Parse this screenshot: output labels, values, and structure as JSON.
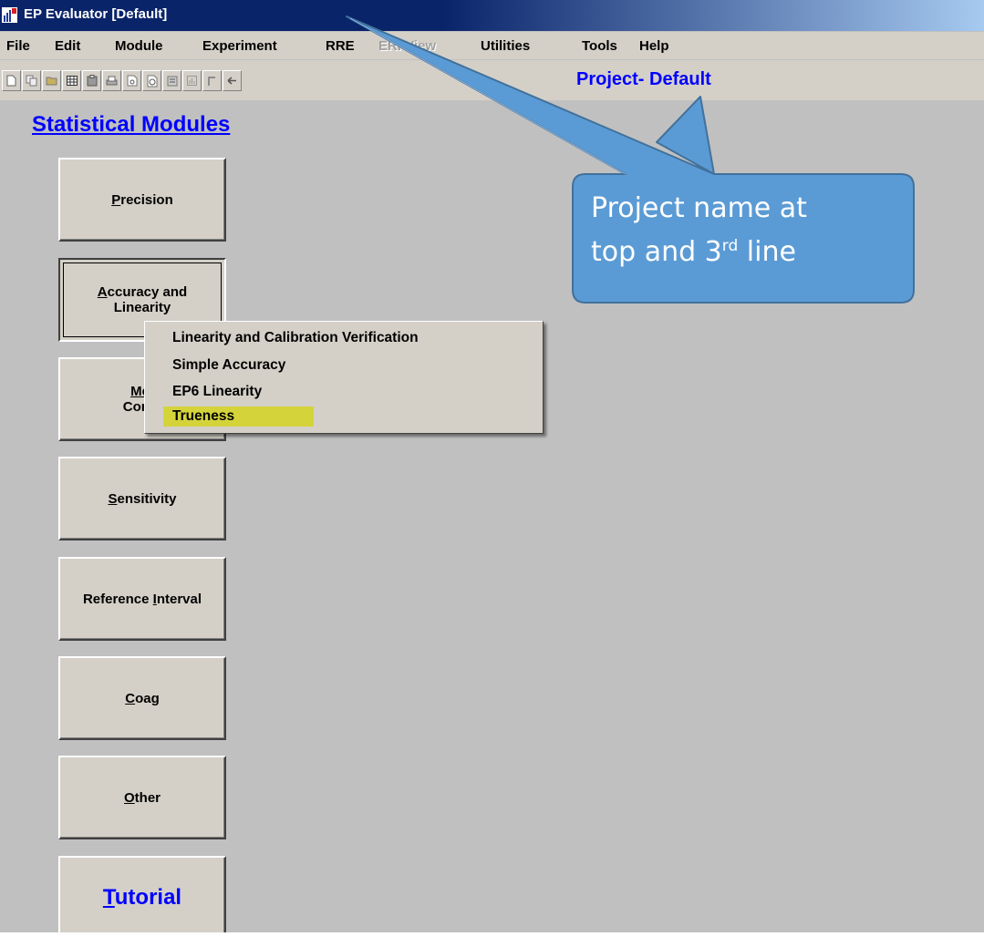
{
  "window": {
    "title": "EP Evaluator [Default]",
    "icon": "ep-evaluator-app-icon"
  },
  "menubar": {
    "items": [
      {
        "label": "File",
        "enabled": true
      },
      {
        "label": "Edit",
        "enabled": true
      },
      {
        "label": "Module",
        "enabled": true
      },
      {
        "label": "Experiment",
        "enabled": true
      },
      {
        "label": "RRE",
        "enabled": true
      },
      {
        "label": "ERI View",
        "enabled": false
      },
      {
        "label": "Utilities",
        "enabled": true
      },
      {
        "label": "Tools",
        "enabled": true
      },
      {
        "label": "Help",
        "enabled": true
      }
    ]
  },
  "toolbar": {
    "icons": [
      "new-document-icon",
      "copy-icon",
      "open-folder-icon",
      "grid-icon",
      "paste-icon",
      "print-icon",
      "print-preview-icon",
      "report-icon",
      "properties-icon",
      "chart-icon",
      "back-corner-icon",
      "back-arrow-icon"
    ],
    "project_label": "Project- Default"
  },
  "main": {
    "heading": "Statistical Modules",
    "modules": [
      {
        "pre": "",
        "u": "P",
        "post": "recision"
      },
      {
        "pre": "",
        "u": "A",
        "post": "ccuracy and Linearity"
      },
      {
        "pre": "",
        "u": "Met",
        "post": "",
        "line2": "Comp"
      },
      {
        "pre": "",
        "u": "S",
        "post": "ensitivity"
      },
      {
        "pre": "Reference ",
        "u": "I",
        "post": "nterval"
      },
      {
        "pre": "",
        "u": "C",
        "post": "oag"
      },
      {
        "pre": "",
        "u": "O",
        "post": "ther"
      },
      {
        "pre": "",
        "u": "T",
        "post": "utorial"
      }
    ]
  },
  "popup_menu": {
    "items": [
      {
        "label": "Linearity and Calibration Verification",
        "highlighted": false
      },
      {
        "label": "Simple Accuracy",
        "highlighted": false
      },
      {
        "label": "EP6 Linearity",
        "highlighted": false
      },
      {
        "label": "Trueness",
        "highlighted": true
      }
    ]
  },
  "callout": {
    "line1": "Project name at",
    "line2_pre": "top and 3",
    "line2_sup": "rd",
    "line2_post": " line",
    "fill_color": "#5b9bd5",
    "border_color": "#41719c"
  },
  "colors": {
    "title_bar": "#0a246a",
    "face": "#d4d0c8",
    "workspace": "#c0c0c0",
    "link_blue": "#0000ff",
    "highlight": "#d4d43a"
  }
}
